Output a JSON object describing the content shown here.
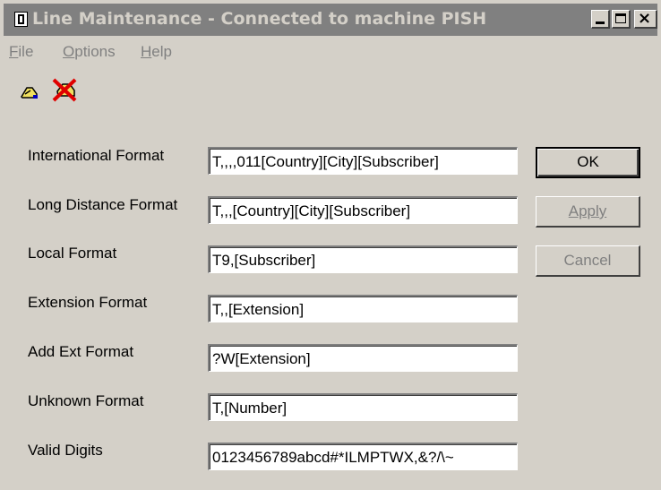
{
  "window": {
    "title": "Line Maintenance - Connected to machine PISH"
  },
  "menu": {
    "file": {
      "key": "F",
      "rest": "ile"
    },
    "options": {
      "key": "O",
      "rest": "ptions"
    },
    "help": {
      "key": "H",
      "rest": "elp"
    }
  },
  "toolbar": {
    "icons": [
      "connect-icon",
      "disconnect-icon"
    ]
  },
  "form": {
    "international": {
      "label": "International Format",
      "value": "T,,,,011[Country][City][Subscriber]"
    },
    "long_distance": {
      "label": "Long Distance Format",
      "value": "T,,,[Country][City][Subscriber]"
    },
    "local": {
      "label": "Local Format",
      "value": "T9,[Subscriber]"
    },
    "extension": {
      "label": "Extension Format",
      "value": "T,,[Extension]"
    },
    "add_ext": {
      "label": "Add Ext Format",
      "value": "?W[Extension]"
    },
    "unknown": {
      "label": "Unknown Format",
      "value": "T,[Number]"
    },
    "valid_digits": {
      "label": "Valid Digits",
      "value": "0123456789abcd#*ILMPTWX,&?/\\~"
    }
  },
  "buttons": {
    "ok": "OK",
    "apply": "Apply",
    "cancel": "Cancel"
  }
}
